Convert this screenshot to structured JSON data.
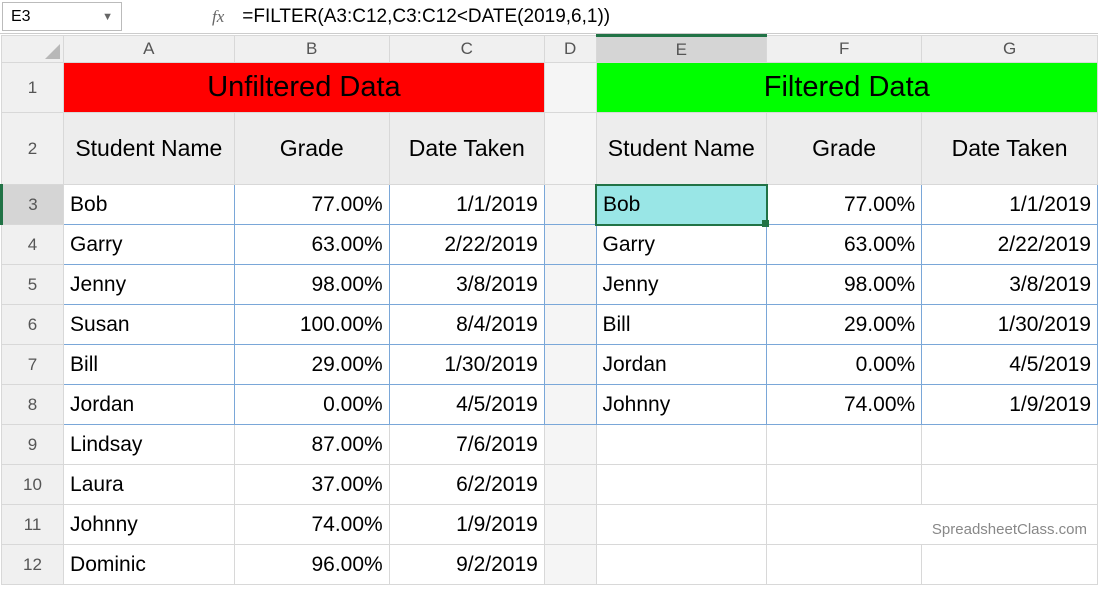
{
  "name_box": "E3",
  "fx_label": "fx",
  "formula": "=FILTER(A3:C12,C3:C12<DATE(2019,6,1))",
  "columns": [
    "A",
    "B",
    "C",
    "D",
    "E",
    "F",
    "G"
  ],
  "rows": [
    "1",
    "2",
    "3",
    "4",
    "5",
    "6",
    "7",
    "8",
    "9",
    "10",
    "11",
    "12"
  ],
  "titles": {
    "unfiltered": "Unfiltered Data",
    "filtered": "Filtered Data"
  },
  "headers": {
    "student": "Student Name",
    "grade": "Grade",
    "date": "Date Taken"
  },
  "unfiltered": [
    {
      "name": "Bob",
      "grade": "77.00%",
      "date": "1/1/2019"
    },
    {
      "name": "Garry",
      "grade": "63.00%",
      "date": "2/22/2019"
    },
    {
      "name": "Jenny",
      "grade": "98.00%",
      "date": "3/8/2019"
    },
    {
      "name": "Susan",
      "grade": "100.00%",
      "date": "8/4/2019"
    },
    {
      "name": "Bill",
      "grade": "29.00%",
      "date": "1/30/2019"
    },
    {
      "name": "Jordan",
      "grade": "0.00%",
      "date": "4/5/2019"
    },
    {
      "name": "Lindsay",
      "grade": "87.00%",
      "date": "7/6/2019"
    },
    {
      "name": "Laura",
      "grade": "37.00%",
      "date": "6/2/2019"
    },
    {
      "name": "Johnny",
      "grade": "74.00%",
      "date": "1/9/2019"
    },
    {
      "name": "Dominic",
      "grade": "96.00%",
      "date": "9/2/2019"
    }
  ],
  "filtered": [
    {
      "name": "Bob",
      "grade": "77.00%",
      "date": "1/1/2019"
    },
    {
      "name": "Garry",
      "grade": "63.00%",
      "date": "2/22/2019"
    },
    {
      "name": "Jenny",
      "grade": "98.00%",
      "date": "3/8/2019"
    },
    {
      "name": "Bill",
      "grade": "29.00%",
      "date": "1/30/2019"
    },
    {
      "name": "Jordan",
      "grade": "0.00%",
      "date": "4/5/2019"
    },
    {
      "name": "Johnny",
      "grade": "74.00%",
      "date": "1/9/2019"
    }
  ],
  "watermark": "SpreadsheetClass.com",
  "chart_data": {
    "type": "table",
    "title": "Unfiltered vs Filtered student grades (FILTER by date < 2019-06-01)",
    "columns": [
      "Student Name",
      "Grade",
      "Date Taken"
    ],
    "unfiltered_rows": [
      [
        "Bob",
        0.77,
        "2019-01-01"
      ],
      [
        "Garry",
        0.63,
        "2019-02-22"
      ],
      [
        "Jenny",
        0.98,
        "2019-03-08"
      ],
      [
        "Susan",
        1.0,
        "2019-08-04"
      ],
      [
        "Bill",
        0.29,
        "2019-01-30"
      ],
      [
        "Jordan",
        0.0,
        "2019-04-05"
      ],
      [
        "Lindsay",
        0.87,
        "2019-07-06"
      ],
      [
        "Laura",
        0.37,
        "2019-06-02"
      ],
      [
        "Johnny",
        0.74,
        "2019-01-09"
      ],
      [
        "Dominic",
        0.96,
        "2019-09-02"
      ]
    ],
    "filtered_rows": [
      [
        "Bob",
        0.77,
        "2019-01-01"
      ],
      [
        "Garry",
        0.63,
        "2019-02-22"
      ],
      [
        "Jenny",
        0.98,
        "2019-03-08"
      ],
      [
        "Bill",
        0.29,
        "2019-01-30"
      ],
      [
        "Jordan",
        0.0,
        "2019-04-05"
      ],
      [
        "Johnny",
        0.74,
        "2019-01-09"
      ]
    ]
  }
}
